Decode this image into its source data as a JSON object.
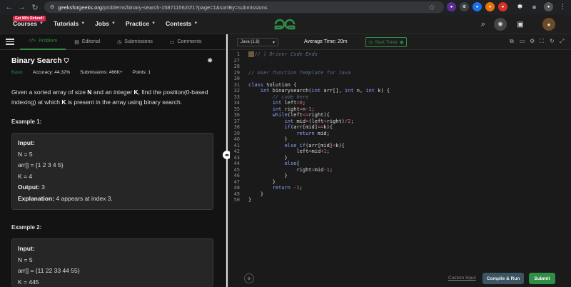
{
  "browser": {
    "url_host": "geeksforgeeks.org",
    "url_path": "/problems/binary-search-1587115620/1?page=1&sortBy=submissions"
  },
  "site_nav": {
    "promo": "Get 90% Refund!",
    "menu": [
      "Courses",
      "Tutorials",
      "Jobs",
      "Practice",
      "Contests"
    ],
    "brand_color": "#2f8d46"
  },
  "problem_tabs": [
    "Problem",
    "Editorial",
    "Submissions",
    "Comments"
  ],
  "problem": {
    "title": "Binary Search",
    "difficulty": "Basic",
    "accuracy": "Accuracy: 44.32%",
    "submissions": "Submissions: 466K+",
    "points": "Points: 1",
    "desc_parts": [
      "Given a sorted array of size ",
      "N",
      " and an integer ",
      "K",
      ", find the position(0-based indexing) at which ",
      "K",
      " is present in the array using binary search."
    ]
  },
  "examples": [
    {
      "title": "Example 1:",
      "input_label": "Input:",
      "lines": [
        "N = 5",
        "arr[] = {1 2 3 4 5}",
        "K = 4"
      ],
      "output_label": "Output:",
      "output": "3",
      "explanation_label": "Explanation:",
      "explanation": "4 appears at index 3."
    },
    {
      "title": "Example 2:",
      "input_label": "Input:",
      "lines": [
        "N = 5",
        "arr[] = {11 22 33 44 55}",
        "K = 445"
      ]
    }
  ],
  "editor": {
    "language": "Java (1.8)",
    "avg_time": "Average Time: 20m",
    "start_timer": "Start Timer",
    "line_numbers": [
      "1",
      "27",
      "28",
      "29",
      "30",
      "31",
      "32",
      "33",
      "34",
      "35",
      "36",
      "37",
      "38",
      "39",
      "40",
      "41",
      "42",
      "43",
      "44",
      "45",
      "46",
      "47",
      "48",
      "49",
      "50"
    ],
    "custom_input": "Custom Input",
    "compile_run": "Compile & Run",
    "submit": "Submit"
  }
}
